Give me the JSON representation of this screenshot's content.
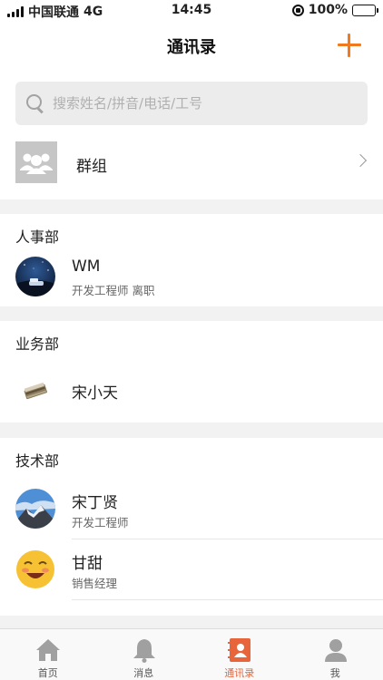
{
  "status_bar": {
    "carrier": "中国联通",
    "network": "4G",
    "time": "14:45",
    "battery": "100%"
  },
  "nav": {
    "title": "通讯录",
    "add_icon": "plus-icon"
  },
  "search": {
    "placeholder": "搜索姓名/拼音/电话/工号",
    "icon": "search-icon"
  },
  "group": {
    "label": "群组"
  },
  "departments": [
    {
      "name": "人事部",
      "members": [
        {
          "name": "WM",
          "subtitle": "开发工程师 离职"
        }
      ]
    },
    {
      "name": "业务部",
      "members": [
        {
          "name": "宋小天",
          "subtitle": ""
        }
      ]
    },
    {
      "name": "技术部",
      "members": [
        {
          "name": "宋丁贤",
          "subtitle": "开发工程师"
        },
        {
          "name": "甘甜",
          "subtitle": "销售经理"
        }
      ]
    }
  ],
  "tabs": [
    {
      "label": "首页",
      "icon": "home-icon",
      "active": false
    },
    {
      "label": "消息",
      "icon": "bell-icon",
      "active": false
    },
    {
      "label": "通讯录",
      "icon": "contacts-book-icon",
      "active": true
    },
    {
      "label": "我",
      "icon": "user-icon",
      "active": false
    }
  ],
  "colors": {
    "accent": "#f07a1d",
    "active_tab": "#e8643a",
    "background": "#f2f2f2"
  }
}
